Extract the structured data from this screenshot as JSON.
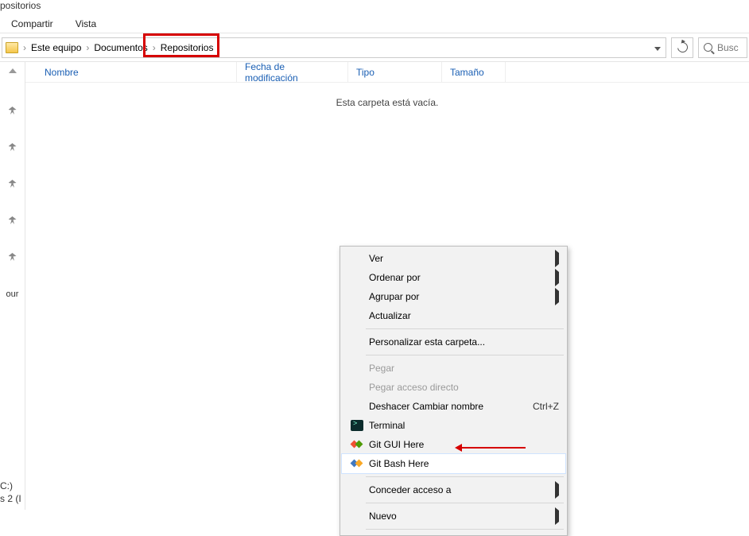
{
  "window": {
    "title_partial": "positorios"
  },
  "ribbon": {
    "share": "Compartir",
    "view": "Vista"
  },
  "breadcrumb": {
    "root": "Este equipo",
    "lvl1": "Documentos",
    "lvl2": "Repositorios"
  },
  "search": {
    "placeholder": "Busc"
  },
  "columns": {
    "name": "Nombre",
    "modified": "Fecha de modificación",
    "type": "Tipo",
    "size": "Tamaño"
  },
  "empty_text": "Esta carpeta está vacía.",
  "nav_partials": {
    "our": "our",
    "drive": "C:)",
    "drive2": "s 2 (I"
  },
  "context_menu": {
    "view": "Ver",
    "sort": "Ordenar por",
    "group": "Agrupar por",
    "refresh": "Actualizar",
    "customize": "Personalizar esta carpeta...",
    "paste": "Pegar",
    "paste_shortcut": "Pegar acceso directo",
    "undo_rename": "Deshacer Cambiar nombre",
    "undo_shortcut": "Ctrl+Z",
    "terminal": "Terminal",
    "git_gui": "Git GUI Here",
    "git_bash": "Git Bash Here",
    "grant_access": "Conceder acceso a",
    "new": "Nuevo"
  }
}
